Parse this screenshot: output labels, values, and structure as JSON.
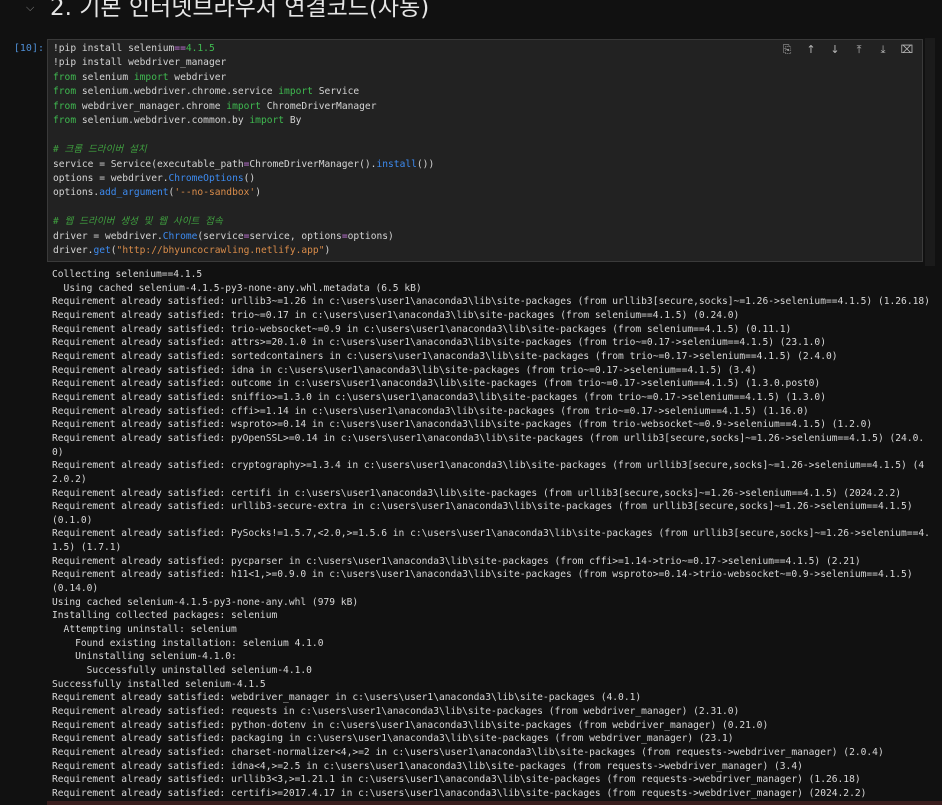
{
  "heading": {
    "caret": "⌵",
    "text": "2. 기본 인터넷브라우저 연결코드(자동)"
  },
  "cell": {
    "prompt": "[10]:",
    "toolbar": {
      "duplicate_icon": "⎘",
      "move_up_icon": "↑",
      "move_down_icon": "↓",
      "insert_above_icon": "⤒",
      "insert_below_icon": "⤓",
      "delete_icon": "⌧"
    },
    "code": [
      "!pip install selenium==4.1.5",
      "!pip install webdriver_manager",
      "from selenium import webdriver",
      "from selenium.webdriver.chrome.service import Service",
      "from webdriver_manager.chrome import ChromeDriverManager",
      "from selenium.webdriver.common.by import By",
      "",
      "# 크롬 드라이버 설치",
      "service = Service(executable_path=ChromeDriverManager().install())",
      "options = webdriver.ChromeOptions()",
      "options.add_argument('--no-sandbox')",
      "",
      "# 웹 드라이버 생성 및 웹 사이트 접속",
      "driver = webdriver.Chrome(service=service, options=options)",
      "driver.get(\"http://bhyuncocrawling.netlify.app\")"
    ]
  },
  "output": [
    "Collecting selenium==4.1.5",
    "  Using cached selenium-4.1.5-py3-none-any.whl.metadata (6.5 kB)",
    "Requirement already satisfied: urllib3~=1.26 in c:\\users\\user1\\anaconda3\\lib\\site-packages (from urllib3[secure,socks]~=1.26->selenium==4.1.5) (1.26.18)",
    "Requirement already satisfied: trio~=0.17 in c:\\users\\user1\\anaconda3\\lib\\site-packages (from selenium==4.1.5) (0.24.0)",
    "Requirement already satisfied: trio-websocket~=0.9 in c:\\users\\user1\\anaconda3\\lib\\site-packages (from selenium==4.1.5) (0.11.1)",
    "Requirement already satisfied: attrs>=20.1.0 in c:\\users\\user1\\anaconda3\\lib\\site-packages (from trio~=0.17->selenium==4.1.5) (23.1.0)",
    "Requirement already satisfied: sortedcontainers in c:\\users\\user1\\anaconda3\\lib\\site-packages (from trio~=0.17->selenium==4.1.5) (2.4.0)",
    "Requirement already satisfied: idna in c:\\users\\user1\\anaconda3\\lib\\site-packages (from trio~=0.17->selenium==4.1.5) (3.4)",
    "Requirement already satisfied: outcome in c:\\users\\user1\\anaconda3\\lib\\site-packages (from trio~=0.17->selenium==4.1.5) (1.3.0.post0)",
    "Requirement already satisfied: sniffio>=1.3.0 in c:\\users\\user1\\anaconda3\\lib\\site-packages (from trio~=0.17->selenium==4.1.5) (1.3.0)",
    "Requirement already satisfied: cffi>=1.14 in c:\\users\\user1\\anaconda3\\lib\\site-packages (from trio~=0.17->selenium==4.1.5) (1.16.0)",
    "Requirement already satisfied: wsproto>=0.14 in c:\\users\\user1\\anaconda3\\lib\\site-packages (from trio-websocket~=0.9->selenium==4.1.5) (1.2.0)",
    "Requirement already satisfied: pyOpenSSL>=0.14 in c:\\users\\user1\\anaconda3\\lib\\site-packages (from urllib3[secure,socks]~=1.26->selenium==4.1.5) (24.0.",
    "0)",
    "Requirement already satisfied: cryptography>=1.3.4 in c:\\users\\user1\\anaconda3\\lib\\site-packages (from urllib3[secure,socks]~=1.26->selenium==4.1.5) (4",
    "2.0.2)",
    "Requirement already satisfied: certifi in c:\\users\\user1\\anaconda3\\lib\\site-packages (from urllib3[secure,socks]~=1.26->selenium==4.1.5) (2024.2.2)",
    "Requirement already satisfied: urllib3-secure-extra in c:\\users\\user1\\anaconda3\\lib\\site-packages (from urllib3[secure,socks]~=1.26->selenium==4.1.5)",
    "(0.1.0)",
    "Requirement already satisfied: PySocks!=1.5.7,<2.0,>=1.5.6 in c:\\users\\user1\\anaconda3\\lib\\site-packages (from urllib3[secure,socks]~=1.26->selenium==4.",
    "1.5) (1.7.1)",
    "Requirement already satisfied: pycparser in c:\\users\\user1\\anaconda3\\lib\\site-packages (from cffi>=1.14->trio~=0.17->selenium==4.1.5) (2.21)",
    "Requirement already satisfied: h11<1,>=0.9.0 in c:\\users\\user1\\anaconda3\\lib\\site-packages (from wsproto>=0.14->trio-websocket~=0.9->selenium==4.1.5)",
    "(0.14.0)",
    "Using cached selenium-4.1.5-py3-none-any.whl (979 kB)",
    "Installing collected packages: selenium",
    "  Attempting uninstall: selenium",
    "    Found existing installation: selenium 4.1.0",
    "    Uninstalling selenium-4.1.0:",
    "      Successfully uninstalled selenium-4.1.0",
    "Successfully installed selenium-4.1.5",
    "Requirement already satisfied: webdriver_manager in c:\\users\\user1\\anaconda3\\lib\\site-packages (4.0.1)",
    "Requirement already satisfied: requests in c:\\users\\user1\\anaconda3\\lib\\site-packages (from webdriver_manager) (2.31.0)",
    "Requirement already satisfied: python-dotenv in c:\\users\\user1\\anaconda3\\lib\\site-packages (from webdriver_manager) (0.21.0)",
    "Requirement already satisfied: packaging in c:\\users\\user1\\anaconda3\\lib\\site-packages (from webdriver_manager) (23.1)",
    "Requirement already satisfied: charset-normalizer<4,>=2 in c:\\users\\user1\\anaconda3\\lib\\site-packages (from requests->webdriver_manager) (2.0.4)",
    "Requirement already satisfied: idna<4,>=2.5 in c:\\users\\user1\\anaconda3\\lib\\site-packages (from requests->webdriver_manager) (3.4)",
    "Requirement already satisfied: urllib3<3,>=1.21.1 in c:\\users\\user1\\anaconda3\\lib\\site-packages (from requests->webdriver_manager) (1.26.18)",
    "Requirement already satisfied: certifi>=2017.4.17 in c:\\users\\user1\\anaconda3\\lib\\site-packages (from requests->webdriver_manager) (2024.2.2)"
  ],
  "colors": {
    "background": "#111111",
    "cell_background": "#222222",
    "keyword": "#3fb950",
    "function": "#3d8bf0",
    "string": "#d98c4a",
    "comment": "#3f9e3f",
    "operator": "#c678dd",
    "prompt": "#4f8fd6"
  }
}
